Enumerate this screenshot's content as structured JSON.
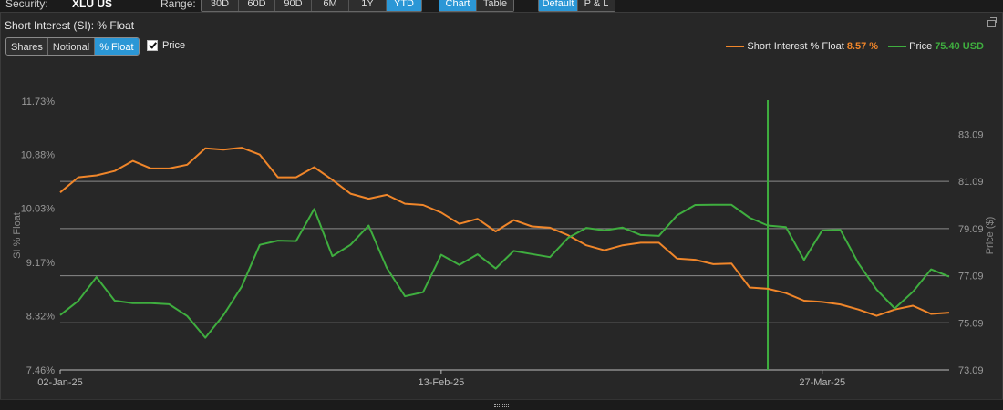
{
  "toolbar": {
    "security_label": "Security:",
    "security_value": "XLU US",
    "range_label": "Range:",
    "ranges": [
      "30D",
      "60D",
      "90D",
      "6M",
      "1Y",
      "YTD"
    ],
    "active_range": "YTD",
    "views": [
      "Chart",
      "Table"
    ],
    "active_view": "Chart",
    "modes": [
      "Default",
      "P & L"
    ],
    "active_mode": "Default"
  },
  "panel": {
    "title": "Short Interest (SI): % Float",
    "metric_tabs": [
      "Shares",
      "Notional",
      "% Float"
    ],
    "active_metric": "% Float",
    "price_checkbox_label": "Price",
    "price_checked": true
  },
  "legend": {
    "si_label": "Short Interest % Float",
    "si_value": "8.57 %",
    "price_label": "Price",
    "price_value": "75.40 USD"
  },
  "colors": {
    "si": "#f0862a",
    "price": "#3fae3f",
    "accent": "#2b97d6",
    "grid": "#8a8a8a",
    "background": "#272727"
  },
  "chart_data": {
    "type": "line",
    "xlabel": "",
    "ylabel_left": "SI % Float",
    "ylabel_right": "Price ($)",
    "x_ticks": [
      "02-Jan-25",
      "13-Feb-25",
      "27-Mar-25"
    ],
    "x_range_days": [
      0,
      98
    ],
    "y_left_ticks": [
      "11.73%",
      "10.88%",
      "10.03%",
      "9.17%",
      "8.32%",
      "7.46%"
    ],
    "y_left_range": [
      7.46,
      11.73
    ],
    "y_right_ticks": [
      "83.09",
      "81.09",
      "79.09",
      "77.09",
      "75.09",
      "73.09"
    ],
    "y_right_range": [
      73.09,
      84.5
    ],
    "crosshair_day": 78,
    "series": [
      {
        "name": "Short Interest % Float",
        "axis": "left",
        "x": [
          0,
          2,
          4,
          6,
          8,
          10,
          12,
          14,
          16,
          18,
          20,
          22,
          24,
          26,
          28,
          30,
          32,
          34,
          36,
          38,
          40,
          42,
          44,
          46,
          48,
          50,
          52,
          54,
          56,
          58,
          60,
          62,
          64,
          66,
          68,
          70,
          72,
          74,
          76,
          78,
          80,
          82,
          84,
          86,
          88,
          90,
          92,
          94,
          96,
          98
        ],
        "values": [
          10.28,
          10.52,
          10.55,
          10.62,
          10.78,
          10.66,
          10.66,
          10.72,
          10.98,
          10.96,
          10.99,
          10.88,
          10.52,
          10.52,
          10.68,
          10.48,
          10.26,
          10.18,
          10.24,
          10.1,
          10.08,
          9.96,
          9.78,
          9.86,
          9.66,
          9.84,
          9.74,
          9.72,
          9.6,
          9.44,
          9.36,
          9.44,
          9.48,
          9.48,
          9.23,
          9.21,
          9.14,
          9.15,
          8.77,
          8.75,
          8.68,
          8.56,
          8.54,
          8.5,
          8.42,
          8.32,
          8.42,
          8.48,
          8.35,
          8.37
        ],
        "_fill": null
      },
      {
        "name": "Price",
        "axis": "right",
        "x": [
          0,
          2,
          4,
          6,
          8,
          10,
          12,
          14,
          16,
          18,
          20,
          22,
          24,
          26,
          28,
          30,
          32,
          34,
          36,
          38,
          40,
          42,
          44,
          46,
          48,
          50,
          52,
          54,
          56,
          58,
          60,
          62,
          64,
          66,
          68,
          70,
          72,
          74,
          76,
          78,
          80,
          82,
          84,
          86,
          88,
          90,
          92,
          94,
          96,
          98
        ],
        "values": [
          75.42,
          76.02,
          77.03,
          76.03,
          75.92,
          75.92,
          75.88,
          75.38,
          74.46,
          75.42,
          76.62,
          78.4,
          78.58,
          78.56,
          79.92,
          77.92,
          78.4,
          79.22,
          77.42,
          76.22,
          76.39,
          77.98,
          77.55,
          78.0,
          77.4,
          78.14,
          78.01,
          77.88,
          78.7,
          79.12,
          79.01,
          79.13,
          78.82,
          78.78,
          79.65,
          80.09,
          80.1,
          80.1,
          79.55,
          79.22,
          79.15,
          77.76,
          79.01,
          79.04,
          77.61,
          76.5,
          75.7,
          76.41,
          77.36,
          77.05
        ]
      }
    ]
  }
}
